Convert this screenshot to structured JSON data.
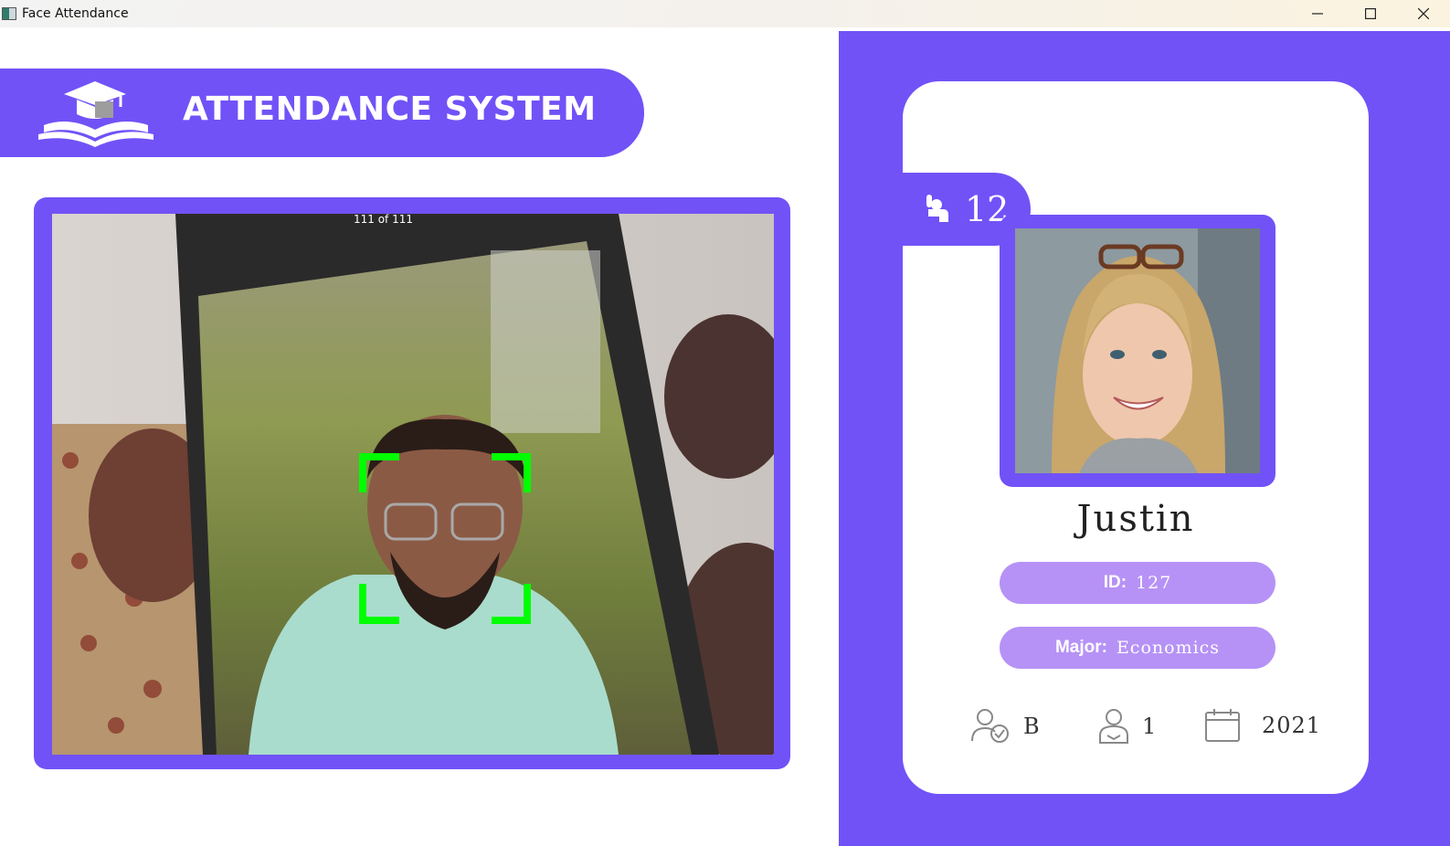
{
  "window": {
    "title": "Face Attendance",
    "controls": [
      "minimize-icon",
      "maximize-icon",
      "close-icon"
    ]
  },
  "banner": {
    "title": "ATTENDANCE SYSTEM",
    "logo_icon": "graduation-cap-book-icon"
  },
  "camera": {
    "overlay_text": "111 of 111",
    "face_box_color": "#00ff00"
  },
  "student": {
    "total_attendance": "12",
    "name": "Justin",
    "id_label": "ID:",
    "id_value": "127",
    "major_label": "Major:",
    "major_value": "Economics",
    "standing": "B",
    "year": "1",
    "starting_year": "2021"
  },
  "colors": {
    "accent": "#7152f7",
    "pill": "#b692f6",
    "face_box": "#00ff00"
  }
}
